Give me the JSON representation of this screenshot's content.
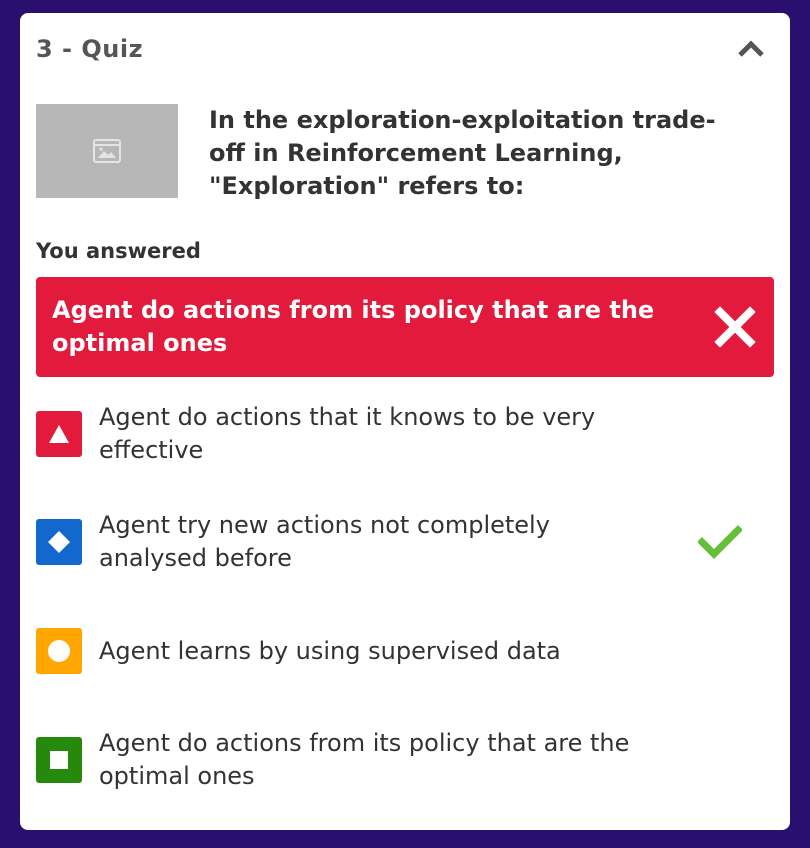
{
  "quiz": {
    "title": "3 - Quiz",
    "question": "In the exploration-exploitation trade-off in Reinforcement Learning, \"Exploration\" refers to:",
    "answered_label": "You answered",
    "your_answer": "Agent do actions from its policy that are the optimal ones",
    "options": [
      {
        "text": "Agent do actions that it knows to be very effective",
        "shape": "triangle",
        "color": "#e21b3c",
        "correct": false
      },
      {
        "text": "Agent try new actions not completely analysed before",
        "shape": "diamond",
        "color": "#1368ce",
        "correct": true
      },
      {
        "text": "Agent learns by using supervised data",
        "shape": "circle",
        "color": "#ffa602",
        "correct": false
      },
      {
        "text": "Agent do actions from its policy that are the optimal ones",
        "shape": "square",
        "color": "#26890c",
        "correct": false
      }
    ]
  },
  "colors": {
    "background": "#2a0f6e",
    "wrong": "#e21b3c",
    "correct_check": "#66bf39",
    "placeholder": "#b7b7b7"
  },
  "icons": {
    "collapse": "chevron-up-icon",
    "image": "image-placeholder-icon",
    "wrong": "x-icon",
    "correct": "checkmark-icon"
  }
}
